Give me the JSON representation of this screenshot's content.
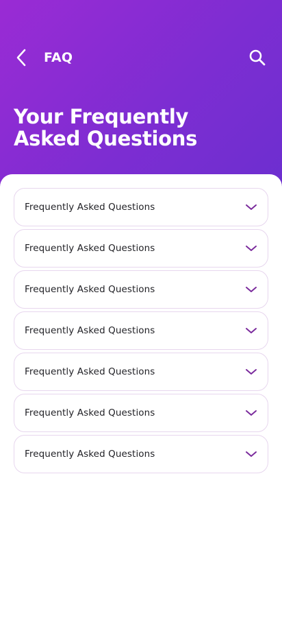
{
  "header": {
    "title": "FAQ",
    "back_icon": "chevron-left-icon",
    "search_icon": "search-icon"
  },
  "hero": {
    "title": "Your Frequently Asked Questions"
  },
  "faq": {
    "items": [
      {
        "question": "Frequently Asked Questions"
      },
      {
        "question": "Frequently Asked Questions"
      },
      {
        "question": "Frequently Asked Questions"
      },
      {
        "question": "Frequently Asked Questions"
      },
      {
        "question": "Frequently Asked Questions"
      },
      {
        "question": "Frequently Asked Questions"
      },
      {
        "question": "Frequently Asked Questions"
      }
    ],
    "expand_icon": "chevron-down-icon"
  },
  "colors": {
    "gradient_start": "#9a2bd4",
    "gradient_end": "#6b2fcf",
    "accent": "#7a2a9c",
    "card_border": "#e7d6ee"
  }
}
